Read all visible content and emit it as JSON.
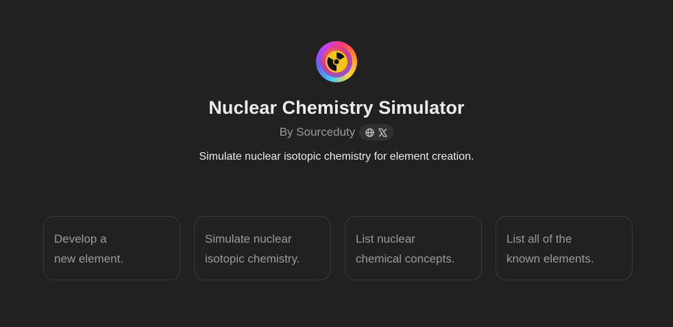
{
  "app": {
    "title": "Nuclear Chemistry Simulator",
    "author_prefix": "By Sourceduty",
    "description": "Simulate nuclear isotopic chemistry for element creation."
  },
  "icons": {
    "logo": "radiation-icon",
    "website": "globe-icon",
    "social": "x-icon"
  },
  "colors": {
    "background": "#212121",
    "title": "#ececec",
    "muted": "#9b9b9b",
    "card_border": "#3a3a3a",
    "pill_bg": "#303030"
  },
  "starters": [
    {
      "line1": "Develop a",
      "line2": "new element."
    },
    {
      "line1": "Simulate nuclear",
      "line2": "isotopic chemistry."
    },
    {
      "line1": "List nuclear",
      "line2": "chemical concepts."
    },
    {
      "line1": "List all of the",
      "line2": "known elements."
    }
  ]
}
